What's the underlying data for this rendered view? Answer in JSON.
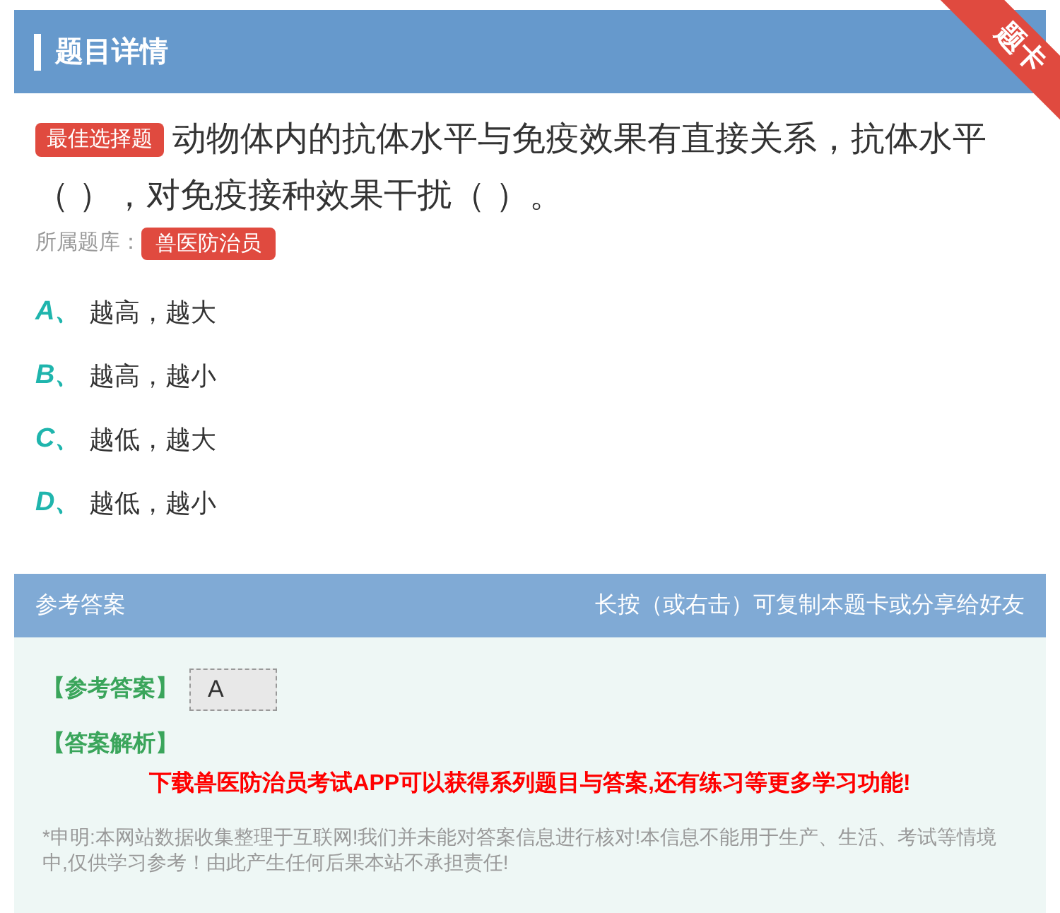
{
  "header": {
    "title": "题目详情",
    "ribbon": "题卡"
  },
  "question": {
    "type_badge": "最佳选择题",
    "lines": [
      "动物体内的抗体水平与免疫效果有直接关系，抗体水平",
      "（ ），对免疫接种效果干扰（ ）。"
    ],
    "bank_label": "所属题库：",
    "bank": "兽医防治员"
  },
  "options": [
    {
      "letter": "A、",
      "text": "越高，越大"
    },
    {
      "letter": "B、",
      "text": "越高，越小"
    },
    {
      "letter": "C、",
      "text": "越低，越大"
    },
    {
      "letter": "D、",
      "text": "越低，越小"
    }
  ],
  "answer_bar": {
    "title": "参考答案",
    "hint": "长按（或右击）可复制本题卡或分享给好友"
  },
  "answer": {
    "label": "【参考答案】",
    "value": "A",
    "analysis_label": "【答案解析】",
    "promo": "下载兽医防治员考试APP可以获得系列题目与答案,还有练习等更多学习功能!",
    "disclaimer": "*申明:本网站数据收集整理于互联网!我们并未能对答案信息进行核对!本信息不能用于生产、生活、考试等情境中,仅供学习参考！由此产生任何后果本站不承担责任!"
  }
}
